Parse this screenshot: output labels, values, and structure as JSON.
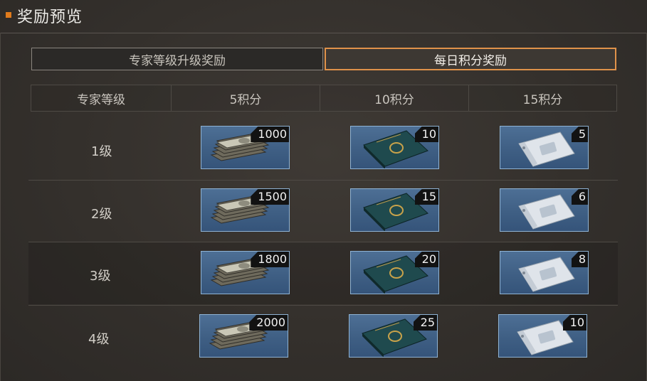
{
  "header": {
    "title": "奖励预览"
  },
  "tabs": {
    "expert": "专家等级升级奖励",
    "daily": "每日积分奖励"
  },
  "columns": [
    "专家等级",
    "5积分",
    "10积分",
    "15积分"
  ],
  "rows": [
    {
      "level": "1级",
      "cash": "1000",
      "book": "10",
      "pack": "5"
    },
    {
      "level": "2级",
      "cash": "1500",
      "book": "15",
      "pack": "6"
    },
    {
      "level": "3级",
      "cash": "1800",
      "book": "20",
      "pack": "8"
    },
    {
      "level": "4级",
      "cash": "2000",
      "book": "25",
      "pack": "10"
    }
  ],
  "colors": {
    "accent": "#e07b1c",
    "item_border": "#8fb3d4",
    "item_bg": "#46688e"
  }
}
